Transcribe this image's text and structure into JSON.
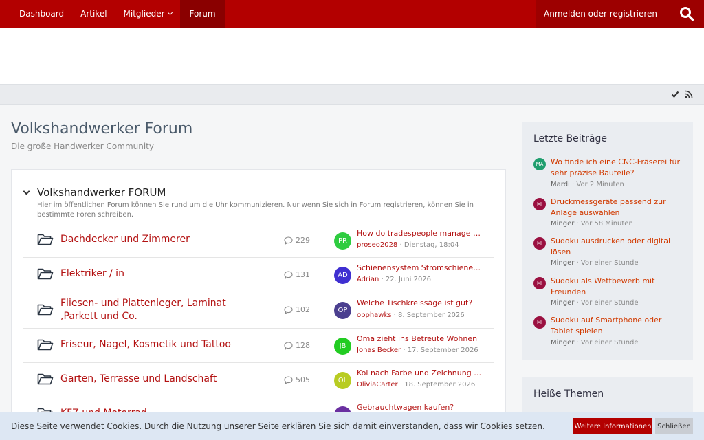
{
  "nav": {
    "items": [
      {
        "label": "Dashboard"
      },
      {
        "label": "Artikel"
      },
      {
        "label": "Mitglieder"
      },
      {
        "label": "Forum"
      }
    ],
    "login_label": "Anmelden oder registrieren"
  },
  "page": {
    "title": "Volkshandwerker Forum",
    "subtitle": "Die große Handwerker Community"
  },
  "category": {
    "title": "Volkshandwerker FORUM",
    "description": "Hier im öffentlichen Forum können Sie rund um die Uhr kommunizieren. Nur wenn Sie sich in Forum registrieren, können Sie in bestimmte Foren schreiben."
  },
  "forums": [
    {
      "name": "Dachdecker und Zimmerer",
      "count": "229",
      "avatar": "PR",
      "avatar_color": "#2ecc40",
      "last_title": "How do tradespeople manage tr...",
      "last_user": "proseo2028",
      "last_date": "Dienstag, 18:04"
    },
    {
      "name": "Elektriker / in",
      "count": "131",
      "avatar": "AD",
      "avatar_color": "#3f2fd1",
      "last_title": "Schienensystem Stromschienen ...",
      "last_user": "Adrian",
      "last_date": "22. Juni 2026"
    },
    {
      "name": "Fliesen- und Plattenleger, Laminat ,Parkett und Co.",
      "count": "102",
      "avatar": "OP",
      "avatar_color": "#4b3f8f",
      "last_title": "Welche Tischkreissäge ist gut?",
      "last_user": "opphawks",
      "last_date": "8. September 2026"
    },
    {
      "name": "Friseur, Nagel, Kosmetik und Tattoo",
      "count": "128",
      "avatar": "JB",
      "avatar_color": "#22cc22",
      "last_title": "Oma zieht ins Betreute Wohnen",
      "last_user": "Jonas Becker",
      "last_date": "17. September 2026"
    },
    {
      "name": "Garten, Terrasse und Landschaft",
      "count": "505",
      "avatar": "OL",
      "avatar_color": "#b8cc22",
      "last_title": "Koi nach Farbe und Zeichnung au...",
      "last_user": "OliviaCarter",
      "last_date": "18. September 2026"
    },
    {
      "name": "KFZ und Motorrad",
      "count": "",
      "avatar": "",
      "avatar_color": "#6a2fa0",
      "last_title": "Gebrauchtwagen kaufen?",
      "last_user": "",
      "last_date": ""
    }
  ],
  "sidebar": {
    "latest_title": "Letzte Beiträge",
    "posts": [
      {
        "avatar": "MA",
        "avatar_color": "#1f9e6e",
        "title": "Wo finde ich eine CNC-Fräserei für sehr präzise Bauteile?",
        "user": "Mardi",
        "time": "Vor 2 Minuten"
      },
      {
        "avatar": "MI",
        "avatar_color": "#9a1040",
        "title": "Druckmessgeräte passend zur Anlage auswählen",
        "user": "Minger",
        "time": "Vor 58 Minuten"
      },
      {
        "avatar": "MI",
        "avatar_color": "#9a1040",
        "title": "Sudoku ausdrucken oder digital lösen",
        "user": "Minger",
        "time": "Vor einer Stunde"
      },
      {
        "avatar": "MI",
        "avatar_color": "#9a1040",
        "title": "Sudoku als Wettbewerb mit Freunden",
        "user": "Minger",
        "time": "Vor einer Stunde"
      },
      {
        "avatar": "MI",
        "avatar_color": "#9a1040",
        "title": "Sudoku auf Smartphone oder Tablet spielen",
        "user": "Minger",
        "time": "Vor einer Stunde"
      }
    ],
    "hot_title": "Heiße Themen"
  },
  "cookie": {
    "text": "Diese Seite verwendet Cookies. Durch die Nutzung unserer Seite erklären Sie sich damit einverstanden, dass wir Cookies setzen.",
    "more_label": "Weitere Informationen",
    "close_label": "Schließen"
  },
  "colors": {
    "brand": "#b30000",
    "link": "#b31111",
    "accent": "#d13a00"
  }
}
